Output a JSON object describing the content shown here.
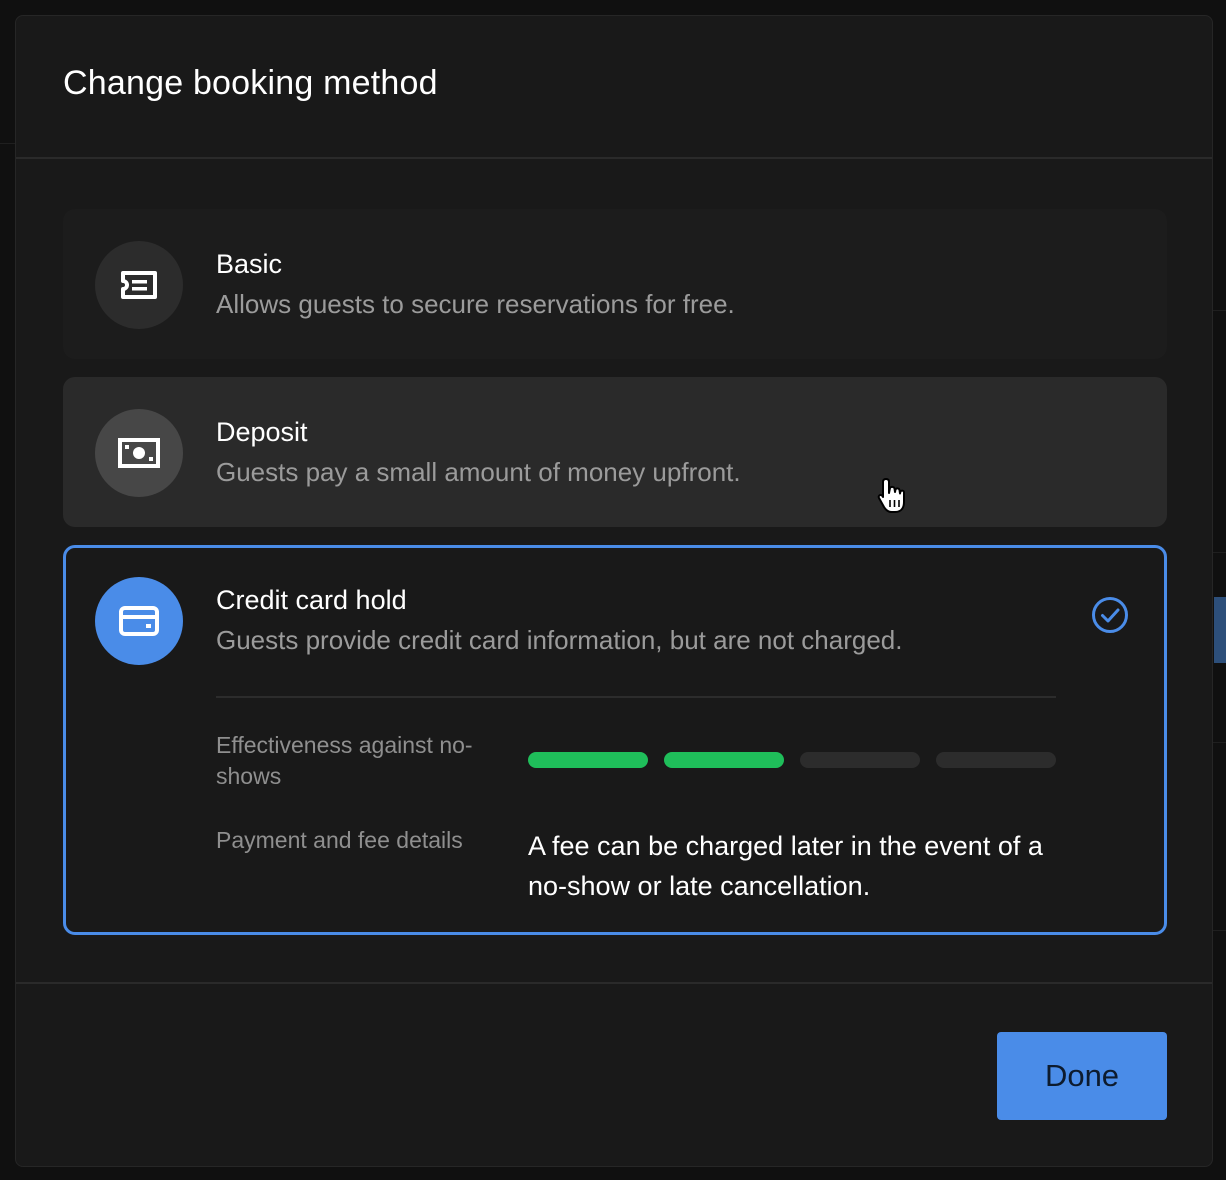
{
  "dialog": {
    "title": "Change booking method"
  },
  "options": [
    {
      "key": "basic",
      "title": "Basic",
      "description": "Allows guests to secure reservations for free.",
      "icon": "ticket-icon",
      "selected": false
    },
    {
      "key": "deposit",
      "title": "Deposit",
      "description": "Guests pay a small amount of money upfront.",
      "icon": "cash-icon",
      "selected": false,
      "hovered": true
    },
    {
      "key": "credit",
      "title": "Credit card hold",
      "description": "Guests provide credit card information, but are not charged.",
      "icon": "credit-card-icon",
      "selected": true,
      "details": {
        "effectiveness_label": "Effectiveness against no-shows",
        "effectiveness_level": 2,
        "effectiveness_max": 4,
        "payment_label": "Payment and fee details",
        "payment_text": "A fee can be charged later in the event of a no-show or late cancellation."
      }
    }
  ],
  "footer": {
    "done_label": "Done"
  },
  "colors": {
    "accent": "#4a8ce8",
    "meter_on": "#1fbe5a",
    "meter_off": "#2c2c2c"
  }
}
